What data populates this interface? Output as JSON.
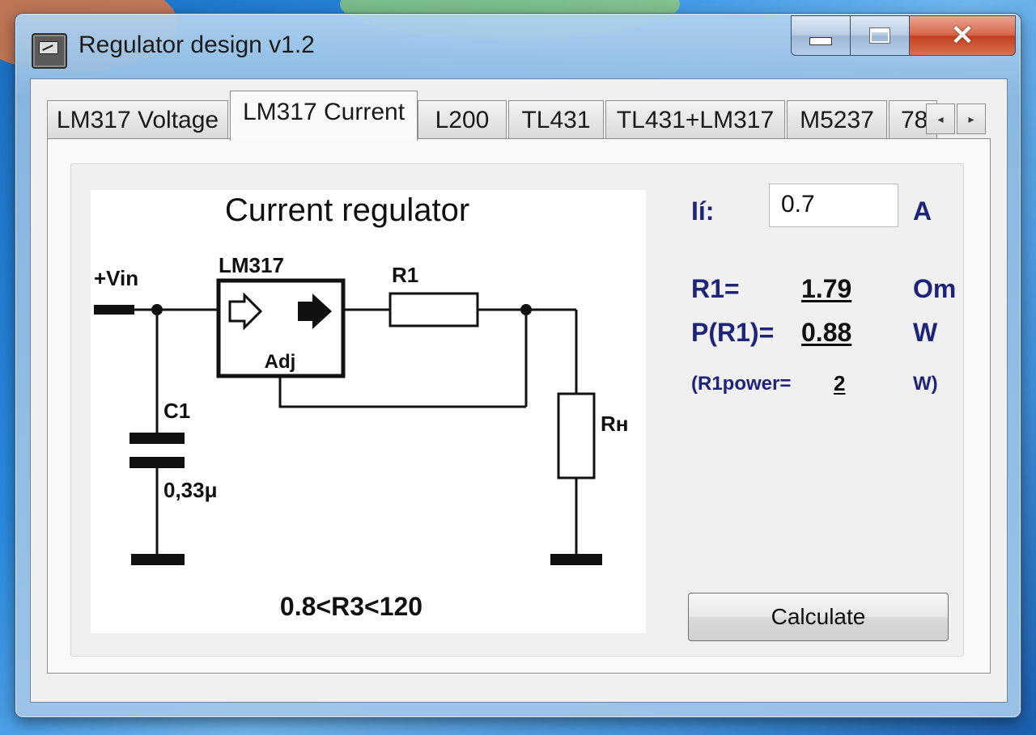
{
  "window": {
    "title": "Regulator design v1.2",
    "close_glyph": "✕",
    "icon": "app-icon"
  },
  "tabs": [
    {
      "label": "LM317 Voltage",
      "active": false
    },
    {
      "label": "LM317 Current",
      "active": true
    },
    {
      "label": "L200",
      "active": false
    },
    {
      "label": "TL431",
      "active": false
    },
    {
      "label": "TL431+LM317",
      "active": false
    },
    {
      "label": "M5237",
      "active": false
    },
    {
      "label": "78",
      "active": false
    }
  ],
  "tab_scroll": {
    "left": "◂",
    "right": "▸"
  },
  "schematic": {
    "title": "Current regulator",
    "vin_label": "+Vin",
    "ic_label": "LM317",
    "adj_label": "Adj",
    "r1_label": "R1",
    "c1_label": "C1",
    "c1_value": "0,33μ",
    "rload_label": "Rн",
    "range_text": "0.8<R3<120"
  },
  "form": {
    "current_label": "Ií:",
    "current_value": "0.7",
    "current_unit": "A",
    "r1_label": "R1=",
    "r1_value": "1.79",
    "r1_unit": "Om",
    "p_label": "P(R1)=",
    "p_value": "0.88",
    "p_unit": "W",
    "r1power_label": "(R1power=",
    "r1power_value": "2",
    "r1power_unit": "W)",
    "calculate_label": "Calculate"
  }
}
